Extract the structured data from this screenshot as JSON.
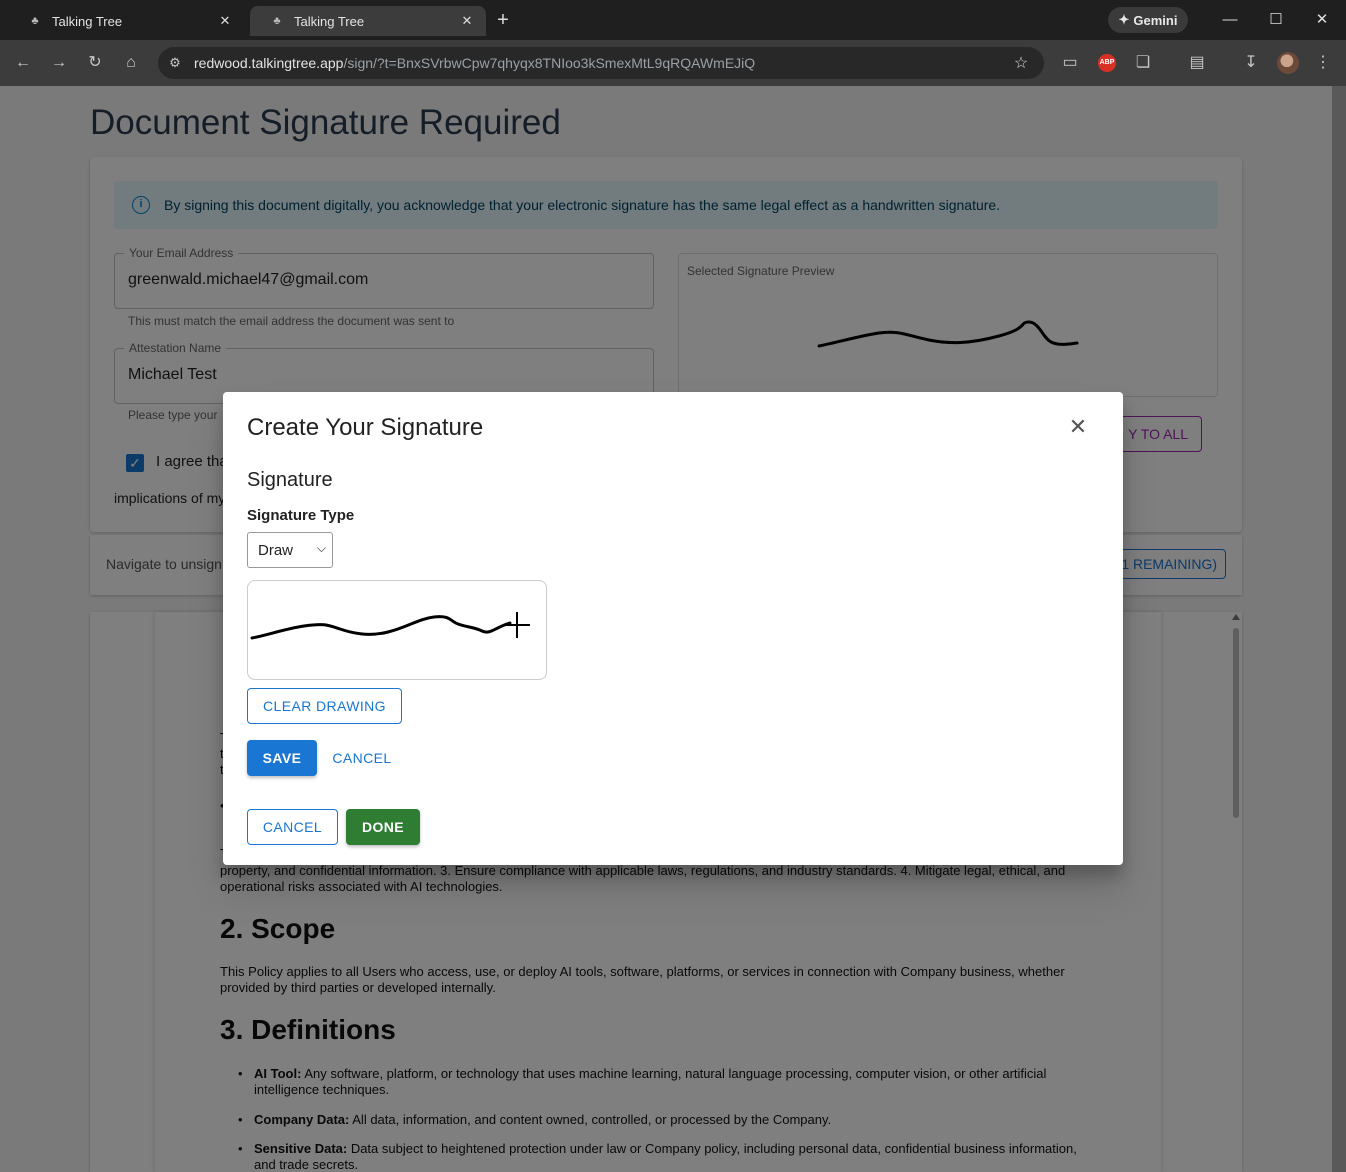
{
  "browser": {
    "tabs": [
      {
        "title": "Talking Tree",
        "active": false
      },
      {
        "title": "Talking Tree",
        "active": true
      }
    ],
    "gemini_label": "Gemini",
    "url_host": "redwood.talkingtree.app",
    "url_path": "/sign/?t=BnxSVrbwCpw7qhyqx8TNIoo3kSmexMtL9qRQAWmEJiQ",
    "abp_label": "ABP"
  },
  "page": {
    "title": "Document Signature Required",
    "alert_text": "By signing this document digitally, you acknowledge that your electronic signature has the same legal effect as a handwritten signature.",
    "email": {
      "label": "Your Email Address",
      "value": "greenwald.michael47@gmail.com",
      "helper": "This must match the email address the document was sent to"
    },
    "attestation": {
      "label": "Attestation Name",
      "value": "Michael Test",
      "helper": "Please type your"
    },
    "agree_label": "I agree tha",
    "agree_checked": true,
    "implications_text": "implications of my",
    "preview_caption": "Selected Signature Preview",
    "apply_all_label": "Y TO ALL",
    "navigate_text": "Navigate to unsign",
    "remaining_label": "1 REMAINING)"
  },
  "document": {
    "partial_lines": [
      "T",
      "t",
      "t"
    ],
    "bullet_fragment": "•",
    "frag_t": "T",
    "purpose_tail_line1": "property, and confidential information. 3. Ensure compliance with applicable laws, regulations, and industry standards. 4. Mitigate legal, ethical, and",
    "purpose_tail_line2": "operational risks associated with AI technologies.",
    "scope_heading": "2. Scope",
    "scope_line1": "This Policy applies to all Users who access, use, or deploy AI tools, software, platforms, or services in connection with Company business, whether",
    "scope_line2": "provided by third parties or developed internally.",
    "definitions_heading": "3. Definitions",
    "definitions": [
      {
        "term": "AI Tool:",
        "line1": " Any software, platform, or technology that uses machine learning, natural language processing, computer vision, or other artificial",
        "line2": "intelligence techniques."
      },
      {
        "term": "Company Data:",
        "line1": " All data, information, and content owned, controlled, or processed by the Company.",
        "line2": ""
      },
      {
        "term": "Sensitive Data:",
        "line1": " Data subject to heightened protection under law or Company policy, including personal data, confidential business information,",
        "line2": "and trade secrets."
      }
    ]
  },
  "modal": {
    "title": "Create Your Signature",
    "section_title": "Signature",
    "type_label": "Signature Type",
    "type_selected": "Draw",
    "clear_label": "CLEAR DRAWING",
    "save_label": "SAVE",
    "cancel_inner_label": "CANCEL",
    "cancel_label": "CANCEL",
    "done_label": "DONE"
  },
  "colors": {
    "primary": "#1976d2",
    "success": "#2e7d32",
    "secondary": "#9c27b0",
    "alert_bg": "#e5f6fd"
  },
  "icons": [
    "tree-favicon",
    "close-icon",
    "plus-icon",
    "gemini-sparkle-icon",
    "minimize-icon",
    "maximize-icon",
    "back-icon",
    "forward-icon",
    "reload-icon",
    "home-icon",
    "site-info-icon",
    "star-icon",
    "extension-icon",
    "puzzle-icon",
    "reading-list-icon",
    "download-icon",
    "menu-icon",
    "info-icon",
    "checkbox-checked-icon",
    "chevron-down-icon",
    "crosshair-cursor-icon"
  ]
}
